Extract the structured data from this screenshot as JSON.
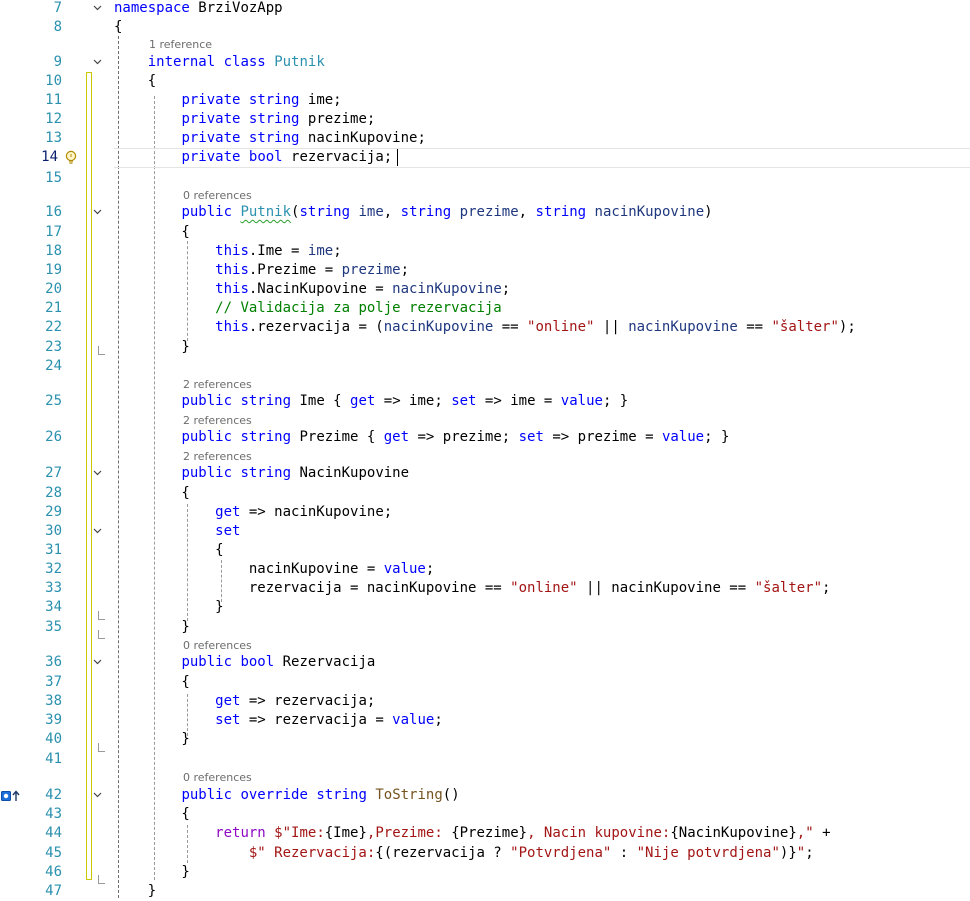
{
  "editor": {
    "namespace": "BrziVozApp",
    "lines": [
      {
        "n": "7",
        "code": "namespace BrziVozApp"
      },
      {
        "n": "8",
        "code": "{"
      },
      {
        "n": "9",
        "code": "internal class Putnik"
      },
      {
        "n": "10",
        "code": "{"
      },
      {
        "n": "11",
        "code": "private string ime;"
      },
      {
        "n": "12",
        "code": "private string prezime;"
      },
      {
        "n": "13",
        "code": "private string nacinKupovine;"
      },
      {
        "n": "14",
        "code": "private bool rezervacija;"
      },
      {
        "n": "15",
        "code": ""
      },
      {
        "n": "16",
        "code": "public Putnik(string ime, string prezime, string nacinKupovine)"
      },
      {
        "n": "17",
        "code": "{"
      },
      {
        "n": "18",
        "code": "this.Ime = ime;"
      },
      {
        "n": "19",
        "code": "this.Prezime = prezime;"
      },
      {
        "n": "20",
        "code": "this.NacinKupovine = nacinKupovine;"
      },
      {
        "n": "21",
        "code": "// Validacija za polje rezervacija"
      },
      {
        "n": "22",
        "code": "this.rezervacija = (nacinKupovine == \"online\" || nacinKupovine == \"šalter\");"
      },
      {
        "n": "23",
        "code": "}"
      },
      {
        "n": "24",
        "code": ""
      },
      {
        "n": "25",
        "code": "public string Ime { get => ime; set => ime = value; }"
      },
      {
        "n": "26",
        "code": "public string Prezime { get => prezime; set => prezime = value; }"
      },
      {
        "n": "27",
        "code": "public string NacinKupovine"
      },
      {
        "n": "28",
        "code": "{"
      },
      {
        "n": "29",
        "code": "get => nacinKupovine;"
      },
      {
        "n": "30",
        "code": "set"
      },
      {
        "n": "31",
        "code": "{"
      },
      {
        "n": "32",
        "code": "nacinKupovine = value;"
      },
      {
        "n": "33",
        "code": "rezervacija = nacinKupovine == \"online\" || nacinKupovine == \"šalter\";"
      },
      {
        "n": "34",
        "code": "}"
      },
      {
        "n": "35",
        "code": "}"
      },
      {
        "n": "36",
        "code": "public bool Rezervacija"
      },
      {
        "n": "37",
        "code": "{"
      },
      {
        "n": "38",
        "code": "get => rezervacija;"
      },
      {
        "n": "39",
        "code": "set => rezervacija = value;"
      },
      {
        "n": "40",
        "code": "}"
      },
      {
        "n": "41",
        "code": ""
      },
      {
        "n": "42",
        "code": "public override string ToString()"
      },
      {
        "n": "43",
        "code": "{"
      },
      {
        "n": "44",
        "code": "return $\"Ime:{Ime},Prezime: {Prezime}, Nacin kupovine:{NacinKupovine},\" +"
      },
      {
        "n": "45",
        "code": "$\" Rezervacija:{(rezervacija ? \"Potvrdjena\" : \"Nije potvrdjena\")}\";"
      },
      {
        "n": "46",
        "code": "}"
      },
      {
        "n": "47",
        "code": "}"
      }
    ],
    "codelens": {
      "class_putnik": "1 reference",
      "ctor_putnik": "0 references",
      "prop_ime": "2 references",
      "prop_prezime": "2 references",
      "prop_nacin": "2 references",
      "prop_rezervacija": "0 references",
      "method_tostring": "0 references"
    },
    "icons": {
      "fold": "chevron-down-icon",
      "quick_action": "lightbulb-icon",
      "override": "override-up-arrow-icon"
    },
    "colors": {
      "keyword": "#0000ff",
      "control_keyword": "#8f08c4",
      "type": "#2b91af",
      "string": "#a31515",
      "comment": "#008000",
      "method": "#74531f",
      "line_number": "#2b91af",
      "change_bar": "#c8c800"
    }
  }
}
